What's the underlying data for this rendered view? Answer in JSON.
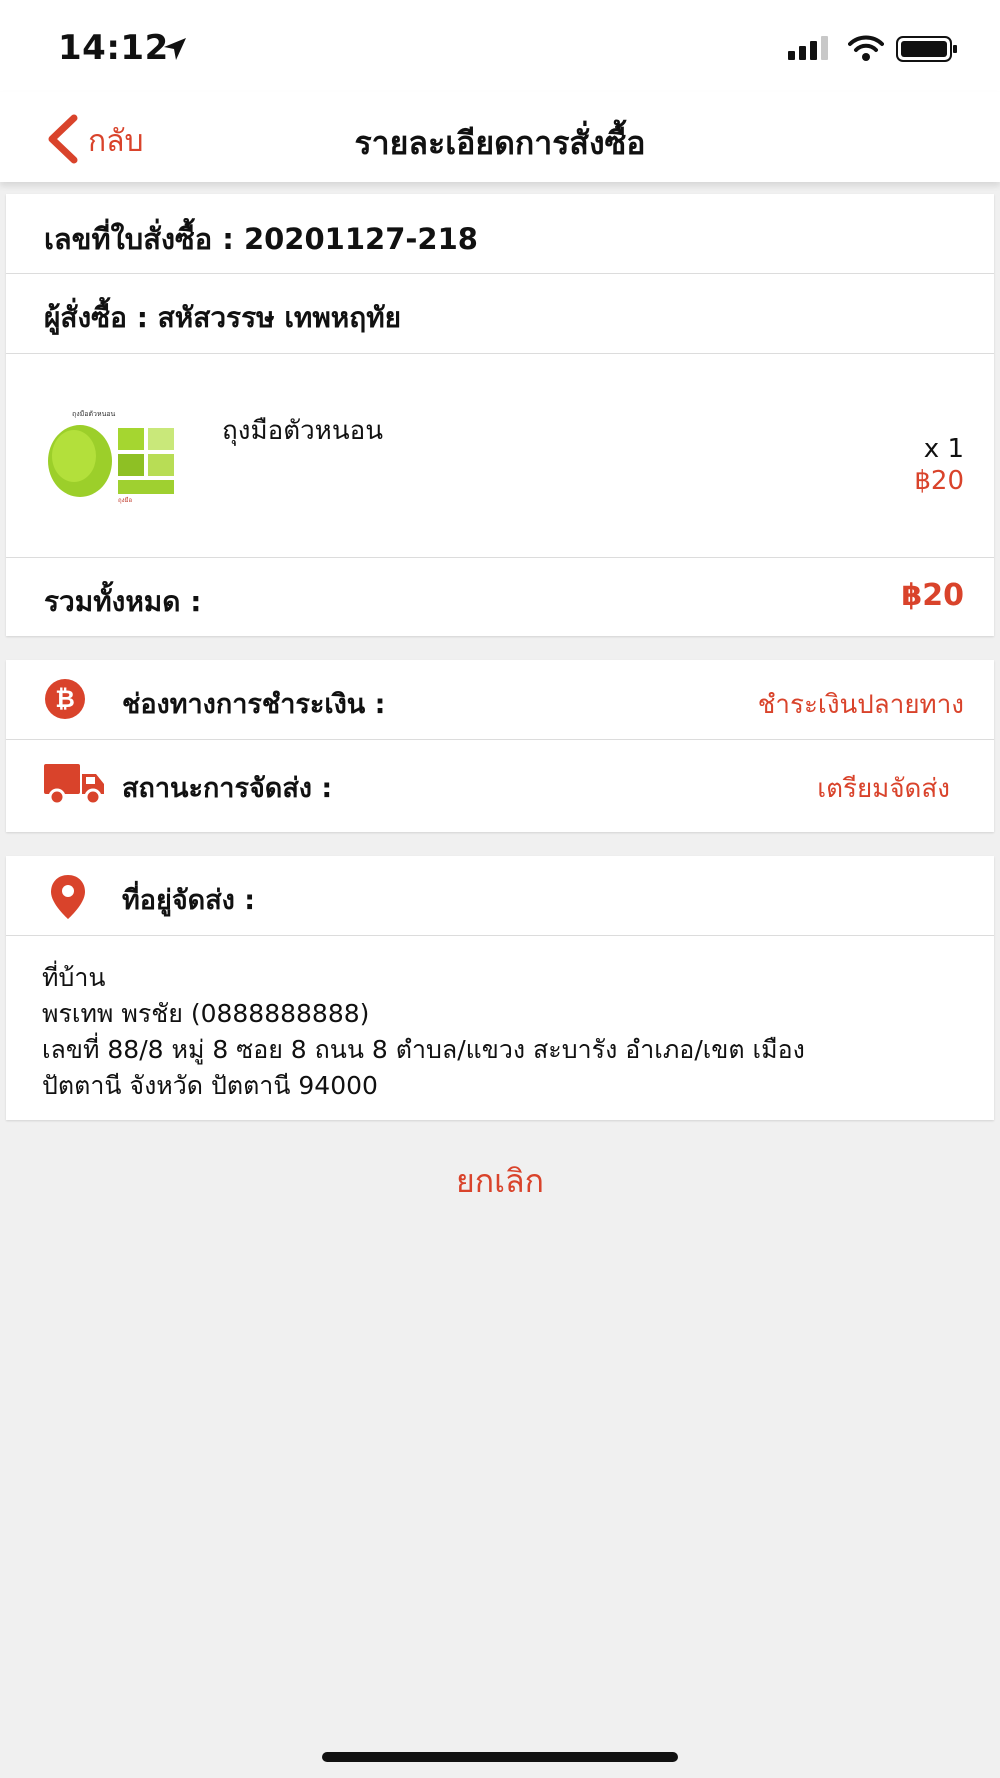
{
  "status": {
    "time": "14:12",
    "icons": [
      "location-arrow-icon",
      "signal-icon",
      "wifi-icon",
      "battery-icon"
    ]
  },
  "nav": {
    "back_label": "กลับ",
    "title": "รายละเอียดการสั่งซื้อ"
  },
  "order": {
    "number_text": "เลขที่ใบสั่งซื้อ : 20201127-218",
    "buyer_text": "ผู้สั่งซื้อ : สหัสวรรษ เทพหฤทัย",
    "item": {
      "name": "ถุงมือตัวหนอน",
      "qty": "x 1",
      "price": "฿20"
    },
    "total_label": "รวมทั้งหมด :",
    "total_value": "฿20"
  },
  "payment": {
    "label": "ช่องทางการชำระเงิน :",
    "value": "ชำระเงินปลายทาง"
  },
  "shipping": {
    "label": "สถานะการจัดส่ง :",
    "value": "เตรียมจัดส่ง"
  },
  "address": {
    "label": "ที่อยู่จัดส่ง :",
    "line1": "ที่บ้าน",
    "line2": "พรเทพ พรชัย (0888888888)",
    "line3": "เลขที่ 88/8 หมู่ 8 ซอย 8 ถนน 8  ตำบล/แขวง สะบารัง อำเภอ/เขต เมือง",
    "line4": "ปัตตานี  จังหวัด ปัตตานี 94000"
  },
  "cancel_label": "ยกเลิก",
  "colors": {
    "accent": "#d9432b",
    "background": "#f0f0f0"
  }
}
